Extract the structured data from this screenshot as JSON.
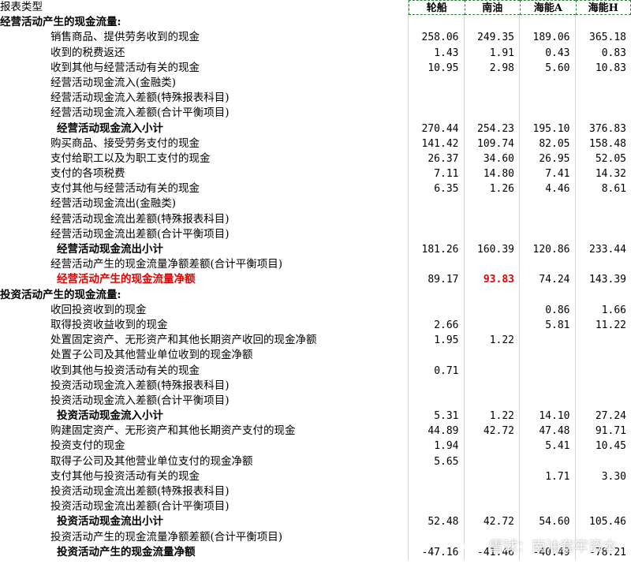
{
  "header": {
    "title": "报表类型",
    "columns": [
      "轮船",
      "南油",
      "海能A",
      "海能H"
    ]
  },
  "rows": [
    {
      "type": "section",
      "label": "经营活动产生的现金流量:",
      "values": [
        "",
        "",
        "",
        ""
      ]
    },
    {
      "type": "indent1",
      "label": "销售商品、提供劳务收到的现金",
      "values": [
        "258.06",
        "249.35",
        "189.06",
        "365.18"
      ]
    },
    {
      "type": "indent1",
      "label": "收到的税费返还",
      "values": [
        "1.43",
        "1.91",
        "0.43",
        "0.83"
      ]
    },
    {
      "type": "indent1",
      "label": "收到其他与经营活动有关的现金",
      "values": [
        "10.95",
        "2.98",
        "5.60",
        "10.83"
      ]
    },
    {
      "type": "indent1",
      "label": "经营活动现金流入(金融类)",
      "values": [
        "",
        "",
        "",
        ""
      ]
    },
    {
      "type": "indent1",
      "label": "经营活动现金流入差额(特殊报表科目)",
      "values": [
        "",
        "",
        "",
        ""
      ]
    },
    {
      "type": "indent1",
      "label": "经营活动现金流入差额(合计平衡项目)",
      "values": [
        "",
        "",
        "",
        ""
      ]
    },
    {
      "type": "subtotal",
      "label": "经营活动现金流入小计",
      "values": [
        "270.44",
        "254.23",
        "195.10",
        "376.83"
      ]
    },
    {
      "type": "indent1",
      "label": "购买商品、接受劳务支付的现金",
      "values": [
        "141.42",
        "109.74",
        "82.05",
        "158.48"
      ]
    },
    {
      "type": "indent1",
      "label": "支付给职工以及为职工支付的现金",
      "values": [
        "26.37",
        "34.60",
        "26.95",
        "52.05"
      ]
    },
    {
      "type": "indent1",
      "label": "支付的各项税费",
      "values": [
        "7.11",
        "14.80",
        "7.41",
        "14.32"
      ]
    },
    {
      "type": "indent1",
      "label": "支付其他与经营活动有关的现金",
      "values": [
        "6.35",
        "1.26",
        "4.46",
        "8.61"
      ]
    },
    {
      "type": "indent1",
      "label": "经营活动现金流出(金融类)",
      "values": [
        "",
        "",
        "",
        ""
      ]
    },
    {
      "type": "indent1",
      "label": "经营活动现金流出差额(特殊报表科目)",
      "values": [
        "",
        "",
        "",
        ""
      ]
    },
    {
      "type": "indent1",
      "label": "经营活动现金流出差额(合计平衡项目)",
      "values": [
        "",
        "",
        "",
        ""
      ]
    },
    {
      "type": "subtotal",
      "label": "经营活动现金流出小计",
      "values": [
        "181.26",
        "160.39",
        "120.86",
        "233.44"
      ]
    },
    {
      "type": "indent1",
      "label": "经营活动产生的现金流量净额差额(合计平衡项目)",
      "values": [
        "",
        "",
        "",
        ""
      ]
    },
    {
      "type": "subtotal highlight",
      "label": "经营活动产生的现金流量净额",
      "values": [
        "89.17",
        "93.83",
        "74.24",
        "143.39"
      ],
      "highlight_col": 1
    },
    {
      "type": "section",
      "label": "投资活动产生的现金流量:",
      "values": [
        "",
        "",
        "",
        ""
      ]
    },
    {
      "type": "indent1",
      "label": "收回投资收到的现金",
      "values": [
        "",
        "",
        "0.86",
        "1.66"
      ]
    },
    {
      "type": "indent1",
      "label": "取得投资收益收到的现金",
      "values": [
        "2.66",
        "",
        "5.81",
        "11.22"
      ]
    },
    {
      "type": "indent1",
      "label": "处置固定资产、无形资产和其他长期资产收回的现金净额",
      "values": [
        "1.95",
        "1.22",
        "",
        ""
      ]
    },
    {
      "type": "indent1",
      "label": "处置子公司及其他营业单位收到的现金净额",
      "values": [
        "",
        "",
        "",
        ""
      ]
    },
    {
      "type": "indent1",
      "label": "收到其他与投资活动有关的现金",
      "values": [
        "0.71",
        "",
        "",
        ""
      ]
    },
    {
      "type": "indent1",
      "label": "投资活动现金流入差额(特殊报表科目)",
      "values": [
        "",
        "",
        "",
        ""
      ]
    },
    {
      "type": "indent1",
      "label": "投资活动现金流入差额(合计平衡项目)",
      "values": [
        "",
        "",
        "",
        ""
      ]
    },
    {
      "type": "subtotal",
      "label": "投资活动现金流入小计",
      "values": [
        "5.31",
        "1.22",
        "14.10",
        "27.24"
      ]
    },
    {
      "type": "indent1",
      "label": "购建固定资产、无形资产和其他长期资产支付的现金",
      "values": [
        "44.89",
        "42.72",
        "47.48",
        "91.71"
      ]
    },
    {
      "type": "indent1",
      "label": "投资支付的现金",
      "values": [
        "1.94",
        "",
        "5.41",
        "10.45"
      ]
    },
    {
      "type": "indent1",
      "label": "取得子公司及其他营业单位支付的现金净额",
      "values": [
        "5.65",
        "",
        "",
        ""
      ]
    },
    {
      "type": "indent1",
      "label": "支付其他与投资活动有关的现金",
      "values": [
        "",
        "",
        "1.71",
        "3.30"
      ]
    },
    {
      "type": "indent1",
      "label": "投资活动现金流出差额(特殊报表科目)",
      "values": [
        "",
        "",
        "",
        ""
      ]
    },
    {
      "type": "indent1",
      "label": "投资活动现金流出差额(合计平衡项目)",
      "values": [
        "",
        "",
        "",
        ""
      ]
    },
    {
      "type": "subtotal",
      "label": "投资活动现金流出小计",
      "values": [
        "52.48",
        "42.72",
        "54.60",
        "105.46"
      ]
    },
    {
      "type": "indent1",
      "label": "投资活动产生的现金流量净额差额(合计平衡项目)",
      "values": [
        "",
        "",
        "",
        ""
      ]
    },
    {
      "type": "subtotal",
      "label": "投资活动产生的现金流量净额",
      "values": [
        "-47.16",
        "-41.46",
        "-40.49",
        "-78.21"
      ]
    }
  ],
  "watermark": {
    "text": "雪球：南油套牢资本"
  }
}
